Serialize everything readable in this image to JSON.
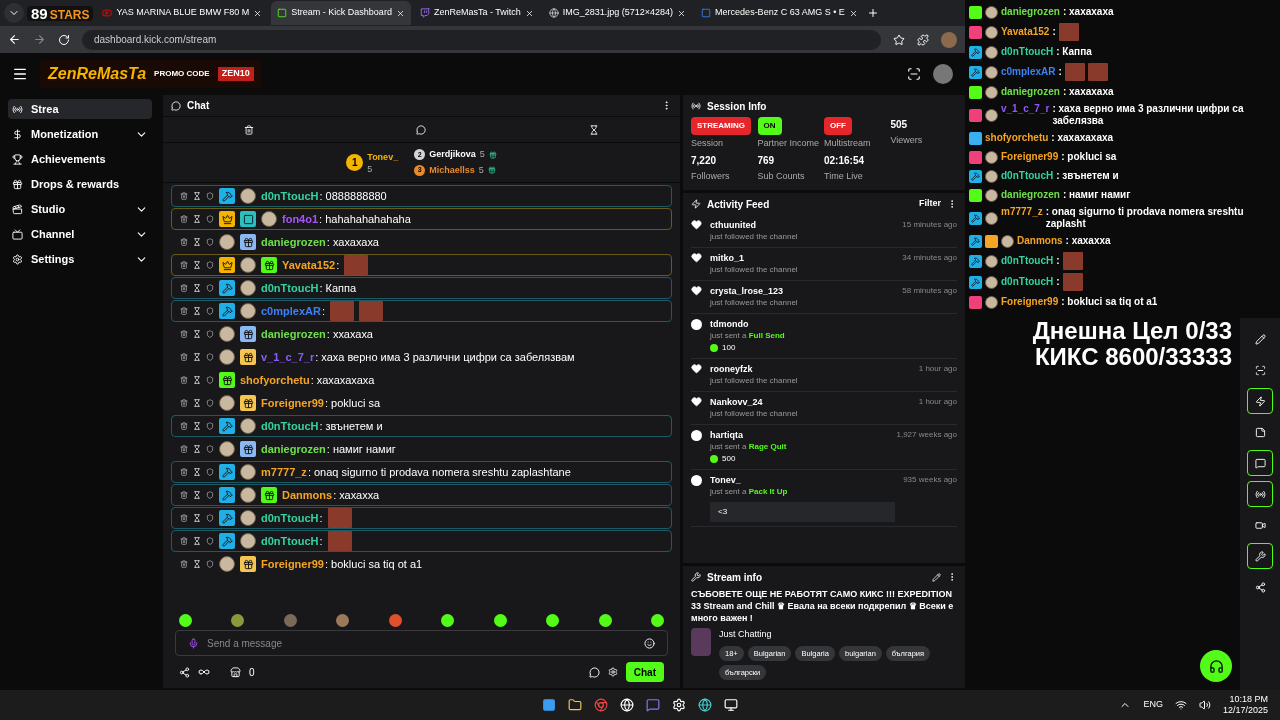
{
  "browser": {
    "logo": {
      "number": "89",
      "word": "STARS"
    },
    "tabs": [
      {
        "title": "YAS MARINA BLUE BMW F80 M",
        "kind": "youtube",
        "selected": false
      },
      {
        "title": "Stream - Kick Dashboard",
        "kind": "kick",
        "selected": true
      },
      {
        "title": "ZenReMasTa - Twitch",
        "kind": "twitch",
        "selected": false
      },
      {
        "title": "IMG_2831.jpg (5712×4284)",
        "kind": "globe",
        "selected": false
      },
      {
        "title": "Mercedes-Benz C 63 AMG S • E",
        "kind": "site",
        "selected": false
      }
    ],
    "url": "dashboard.kick.com/stream"
  },
  "promo": {
    "name": "ZenReMasTa",
    "caption": "PROMO CODE",
    "code": "ZEN10"
  },
  "sidebar": {
    "items": [
      {
        "label": "Strea",
        "kind": "stream",
        "selected": true,
        "expandable": false
      },
      {
        "label": "Monetization",
        "kind": "money",
        "selected": false,
        "expandable": true
      },
      {
        "label": "Achievements",
        "kind": "trophy",
        "selected": false,
        "expandable": false
      },
      {
        "label": "Drops & rewards",
        "kind": "drops",
        "selected": false,
        "expandable": false
      },
      {
        "label": "Studio",
        "kind": "studio",
        "selected": false,
        "expandable": true
      },
      {
        "label": "Channel",
        "kind": "channel",
        "selected": false,
        "expandable": true
      },
      {
        "label": "Settings",
        "kind": "settings",
        "selected": false,
        "expandable": true
      }
    ]
  },
  "chat": {
    "title": "Chat",
    "top_gifters": [
      {
        "rank": "1",
        "name": "Tonev_",
        "count": "5",
        "color": "#f5b400"
      },
      {
        "rank": "2",
        "name": "Gerdjikova",
        "count": "5",
        "color": "#d4d4d8"
      },
      {
        "rank": "3",
        "name": "Michaellss",
        "count": "5",
        "color": "#e8892c"
      }
    ],
    "messages": [
      {
        "kind": "mod",
        "user": "d0nTtoucH",
        "color": "#34d3a0",
        "text": ": 0888888880",
        "badges": [
          {
            "kind": "mod"
          },
          {
            "kind": "avatar"
          }
        ]
      },
      {
        "kind": "vip",
        "user": "fon4o1",
        "color": "#a855f7",
        "text": ": hahahahahahaha",
        "badges": [
          {
            "kind": "vip"
          },
          {
            "kind": "og"
          },
          {
            "kind": "avatar"
          }
        ]
      },
      {
        "kind": "plain",
        "user": "daniegrozen",
        "color": "#6ee04a",
        "text": ": хахахаха",
        "badges": [
          {
            "kind": "avatar"
          },
          {
            "kind": "gift_blue"
          }
        ]
      },
      {
        "kind": "vip",
        "user": "Yavata152",
        "color": "#f5a524",
        "text": ":",
        "badges": [
          {
            "kind": "vip"
          },
          {
            "kind": "avatar"
          },
          {
            "kind": "gift_green"
          }
        ],
        "emotes": [
          {
            "kind": "emote"
          }
        ]
      },
      {
        "kind": "mod",
        "user": "d0nTtoucH",
        "color": "#34d3a0",
        "text": ": Каппа",
        "badges": [
          {
            "kind": "mod"
          },
          {
            "kind": "avatar"
          }
        ]
      },
      {
        "kind": "mod",
        "user": "c0mplexAR",
        "color": "#3b82f6",
        "text": ":",
        "badges": [
          {
            "kind": "mod"
          },
          {
            "kind": "avatar"
          }
        ],
        "emotes": [
          {
            "kind": "emote"
          },
          {
            "kind": "emote"
          }
        ]
      },
      {
        "kind": "plain",
        "user": "daniegrozen",
        "color": "#6ee04a",
        "text": ": ххахаха",
        "badges": [
          {
            "kind": "avatar"
          },
          {
            "kind": "gift_blue"
          }
        ]
      },
      {
        "kind": "plain",
        "user": "v_1_c_7_r",
        "color": "#8b5cf6",
        "text": ": хаха верно има 3 различни цифри са забелязвам",
        "badges": [
          {
            "kind": "avatar"
          },
          {
            "kind": "gift_gold"
          }
        ]
      },
      {
        "kind": "plain",
        "user": "shofyorchetu",
        "color": "#f5a524",
        "text": ": хахахахаха",
        "badges": [
          {
            "kind": "gift_green"
          }
        ]
      },
      {
        "kind": "plain",
        "user": "Foreigner99",
        "color": "#f5a524",
        "text": ": pokluci sa",
        "badges": [
          {
            "kind": "avatar"
          },
          {
            "kind": "gift_gold"
          }
        ]
      },
      {
        "kind": "mod",
        "user": "d0nTtoucH",
        "color": "#34d3a0",
        "text": ": звънетем и",
        "badges": [
          {
            "kind": "mod"
          },
          {
            "kind": "avatar"
          }
        ]
      },
      {
        "kind": "plain",
        "user": "daniegrozen",
        "color": "#6ee04a",
        "text": ": намиг намиг",
        "badges": [
          {
            "kind": "avatar"
          },
          {
            "kind": "gift_blue"
          }
        ]
      },
      {
        "kind": "mod",
        "user": "m7777_z",
        "color": "#f5a524",
        "text": ": onaq sigurno ti prodava nomera sreshtu zaplashtane",
        "badges": [
          {
            "kind": "mod"
          },
          {
            "kind": "avatar"
          }
        ]
      },
      {
        "kind": "mod",
        "user": "Danmons",
        "color": "#f5a524",
        "text": ": хахахха",
        "badges": [
          {
            "kind": "mod"
          },
          {
            "kind": "avatar"
          },
          {
            "kind": "gift_green"
          }
        ]
      },
      {
        "kind": "mod",
        "user": "d0nTtoucH",
        "color": "#34d3a0",
        "text": ":",
        "badges": [
          {
            "kind": "mod"
          },
          {
            "kind": "avatar"
          }
        ],
        "emotes": [
          {
            "kind": "emote"
          }
        ]
      },
      {
        "kind": "mod",
        "user": "d0nTtoucH",
        "color": "#34d3a0",
        "text": ":",
        "badges": [
          {
            "kind": "mod"
          },
          {
            "kind": "avatar"
          }
        ],
        "emotes": [
          {
            "kind": "emote"
          }
        ]
      },
      {
        "kind": "plain",
        "user": "Foreigner99",
        "color": "#f5a524",
        "text": ": bokluci sa tiq ot a1",
        "badges": [
          {
            "kind": "avatar"
          },
          {
            "kind": "gift_gold"
          }
        ]
      }
    ],
    "emote_bar": [
      {
        "color": "#53fc18"
      },
      {
        "color": "#8a9a3a"
      },
      {
        "color": "#7a6a5a"
      },
      {
        "color": "#9a7a5a"
      },
      {
        "color": "#e0502a"
      },
      {
        "color": "#53fc18"
      },
      {
        "color": "#53fc18"
      },
      {
        "color": "#53fc18"
      },
      {
        "color": "#53fc18"
      },
      {
        "color": "#53fc18"
      }
    ],
    "input": {
      "placeholder": "Send a message"
    },
    "points": "0",
    "send_button": "Chat"
  },
  "session_info": {
    "title": "Session Info",
    "stats": [
      {
        "kind": "status",
        "color": "#e5262b",
        "value": "STREAMING",
        "label": "Session"
      },
      {
        "kind": "status",
        "color": "#53fc18",
        "value": "ON",
        "label": "Partner Income"
      },
      {
        "kind": "status",
        "color": "#e5262b",
        "value": "OFF",
        "label": "Multistream"
      },
      {
        "kind": "number",
        "value": "505",
        "label": "Viewers"
      },
      {
        "kind": "number",
        "value": "7,220",
        "label": "Followers"
      },
      {
        "kind": "number",
        "value": "769",
        "label": "Sub Counts"
      },
      {
        "kind": "number",
        "value": "02:16:54",
        "label": "Time Live"
      }
    ]
  },
  "activity_feed": {
    "title": "Activity Feed",
    "filter": "Filter",
    "items": [
      {
        "kind": "follow",
        "user": "cthuunited",
        "action": "just followed the channel",
        "time": "15 minutes ago"
      },
      {
        "kind": "follow",
        "user": "mitko_1",
        "action": "just followed the channel",
        "time": "34 minutes ago"
      },
      {
        "kind": "follow",
        "user": "crysta_lrose_123",
        "action": "just followed the channel",
        "time": "58 minutes ago"
      },
      {
        "kind": "gift",
        "user": "tdmondo",
        "action": "just sent a",
        "gift": "Full Send",
        "amount": "100"
      },
      {
        "kind": "follow",
        "user": "rooneyfzk",
        "action": "just followed the channel",
        "time": "1 hour ago"
      },
      {
        "kind": "follow",
        "user": "Nankovv_24",
        "action": "just followed the channel",
        "time": "1 hour ago"
      },
      {
        "kind": "gift",
        "user": "hartiqta",
        "action": "just sent a",
        "gift": "Rage Quit",
        "amount": "500",
        "time": "1,927 weeks ago"
      },
      {
        "kind": "gift",
        "user": "Tonev_",
        "action": "just sent a",
        "gift": "Pack It Up",
        "time": "935 weeks ago",
        "message": "<3"
      }
    ]
  },
  "stream_info": {
    "title": "Stream info",
    "stream_title": "СЪБОВЕТЕ ОЩЕ НЕ РАБОТЯТ САМО КИКС !!! EXPEDITION 33 Stream and Chill ♛ Евала на всеки подкрепил ♛ Всеки е много важен !",
    "category": "Just Chatting",
    "tags": [
      "18+",
      "Bulgarian",
      "Bulgaria",
      "bulgarian",
      "българия",
      "български"
    ]
  },
  "overlay_chat": [
    {
      "user": "daniegrozen",
      "color": "#6ee04a",
      "text": ": хахахаха",
      "badges": [
        {
          "kind": "cube_green"
        },
        {
          "kind": "avatar"
        }
      ]
    },
    {
      "user": "Yavata152",
      "color": "#f5a524",
      "text": ":",
      "badges": [
        {
          "kind": "cube_pink"
        },
        {
          "kind": "avatar"
        }
      ],
      "emotes": [
        {
          "kind": "emote"
        }
      ]
    },
    {
      "user": "d0nTtoucH",
      "color": "#34d3a0",
      "text": ": Каппа",
      "badges": [
        {
          "kind": "mod"
        },
        {
          "kind": "avatar"
        }
      ]
    },
    {
      "user": "c0mplexAR",
      "color": "#3b82f6",
      "text": ":",
      "badges": [
        {
          "kind": "mod"
        },
        {
          "kind": "avatar"
        }
      ],
      "emotes": [
        {
          "kind": "emote"
        },
        {
          "kind": "emote"
        }
      ]
    },
    {
      "user": "daniegrozen",
      "color": "#6ee04a",
      "text": ": хахахаха",
      "badges": [
        {
          "kind": "cube_green"
        },
        {
          "kind": "avatar"
        }
      ]
    },
    {
      "user": "v_1_c_7_r",
      "color": "#8b5cf6",
      "text": ": хаха верно има 3 различни цифри са забелязва",
      "badges": [
        {
          "kind": "cube_pink"
        },
        {
          "kind": "avatar"
        }
      ]
    },
    {
      "user": "shofyorchetu",
      "color": "#f5a524",
      "text": ": хахахахаха",
      "badges": [
        {
          "kind": "cube_blue"
        }
      ]
    },
    {
      "user": "Foreigner99",
      "color": "#f5a524",
      "text": ": pokluci sa",
      "badges": [
        {
          "kind": "cube_pink"
        },
        {
          "kind": "avatar"
        }
      ]
    },
    {
      "user": "d0nTtoucH",
      "color": "#34d3a0",
      "text": ": звънетем и",
      "badges": [
        {
          "kind": "mod"
        },
        {
          "kind": "avatar"
        }
      ]
    },
    {
      "user": "daniegrozen",
      "color": "#6ee04a",
      "text": ": намиг намиг",
      "badges": [
        {
          "kind": "cube_green"
        },
        {
          "kind": "avatar"
        }
      ]
    },
    {
      "user": "m7777_z",
      "color": "#f5a524",
      "text": ": onaq sigurno ti prodava nomera sreshtu zaplasht",
      "badges": [
        {
          "kind": "mod"
        },
        {
          "kind": "avatar"
        }
      ]
    },
    {
      "user": "Danmons",
      "color": "#f5a524",
      "text": ": хахахха",
      "badges": [
        {
          "kind": "mod"
        },
        {
          "kind": "cube_gold"
        },
        {
          "kind": "avatar"
        }
      ]
    },
    {
      "user": "d0nTtoucH",
      "color": "#34d3a0",
      "text": ":",
      "badges": [
        {
          "kind": "mod"
        },
        {
          "kind": "avatar"
        }
      ],
      "emotes": [
        {
          "kind": "emote"
        }
      ]
    },
    {
      "user": "d0nTtoucH",
      "color": "#34d3a0",
      "text": ":",
      "badges": [
        {
          "kind": "mod"
        },
        {
          "kind": "avatar"
        }
      ],
      "emotes": [
        {
          "kind": "emote"
        }
      ]
    },
    {
      "user": "Foreigner99",
      "color": "#f5a524",
      "text": ": bokluci sa tiq ot a1",
      "badges": [
        {
          "kind": "cube_pink"
        },
        {
          "kind": "avatar"
        }
      ]
    }
  ],
  "goal": [
    "Днешна Цел 0/33",
    "КИКС 8600/33333"
  ],
  "rail": [
    {
      "kind": "edit",
      "active": false
    },
    {
      "kind": "scan",
      "active": false
    },
    {
      "kind": "bolt",
      "active": true
    },
    {
      "kind": "note",
      "active": false
    },
    {
      "kind": "chat",
      "active": true
    },
    {
      "kind": "broadcast",
      "active": true
    },
    {
      "kind": "video",
      "active": false
    },
    {
      "kind": "wrench",
      "active": true
    },
    {
      "kind": "share",
      "active": false
    }
  ],
  "taskbar": {
    "language": "ENG",
    "time": "10:18 PM",
    "date": "12/17/2025"
  }
}
